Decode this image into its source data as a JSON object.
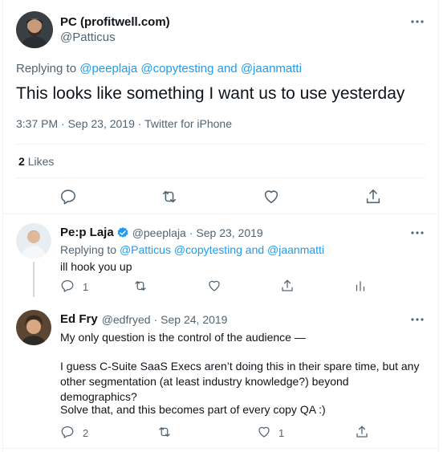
{
  "main_tweet": {
    "author_name": "PC (profitwell.com)",
    "author_handle": "@Patticus",
    "replying_label": "Replying to",
    "replying_mentions": [
      "@peeplaja",
      "@copytesting",
      "and",
      "@jaanmatti"
    ],
    "text": "This looks like something I want us to use yesterday",
    "meta": "3:37 PM · Sep 23, 2019 · Twitter for iPhone",
    "likes_count": "2",
    "likes_label": "Likes"
  },
  "reply1": {
    "author_name": "Pe:p Laja",
    "author_handle": "@peeplaja",
    "date": "· Sep 23, 2019",
    "replying_label": "Replying to",
    "replying_mentions": [
      "@Patticus",
      "@copytesting",
      "and",
      "@jaanmatti"
    ],
    "text": "ill hook you up",
    "reply_count": "1",
    "verified_color": "#1d9bf0"
  },
  "reply2": {
    "author_name": "Ed Fry",
    "author_handle": "@edfryed",
    "date": "· Sep 24, 2019",
    "text_p1": "My only question is the control of the audience —",
    "text_p2": "I guess C-Suite SaaS Execs aren’t doing this in their spare time, but any other segmentation (at least industry knowledge?) beyond demographics?",
    "text_p3": "Solve that, and this becomes part of every copy QA :)",
    "reply_count": "2",
    "like_count": "1"
  },
  "colors": {
    "accent": "#1d9bf0",
    "muted": "#536471",
    "border": "#eff3f4"
  }
}
